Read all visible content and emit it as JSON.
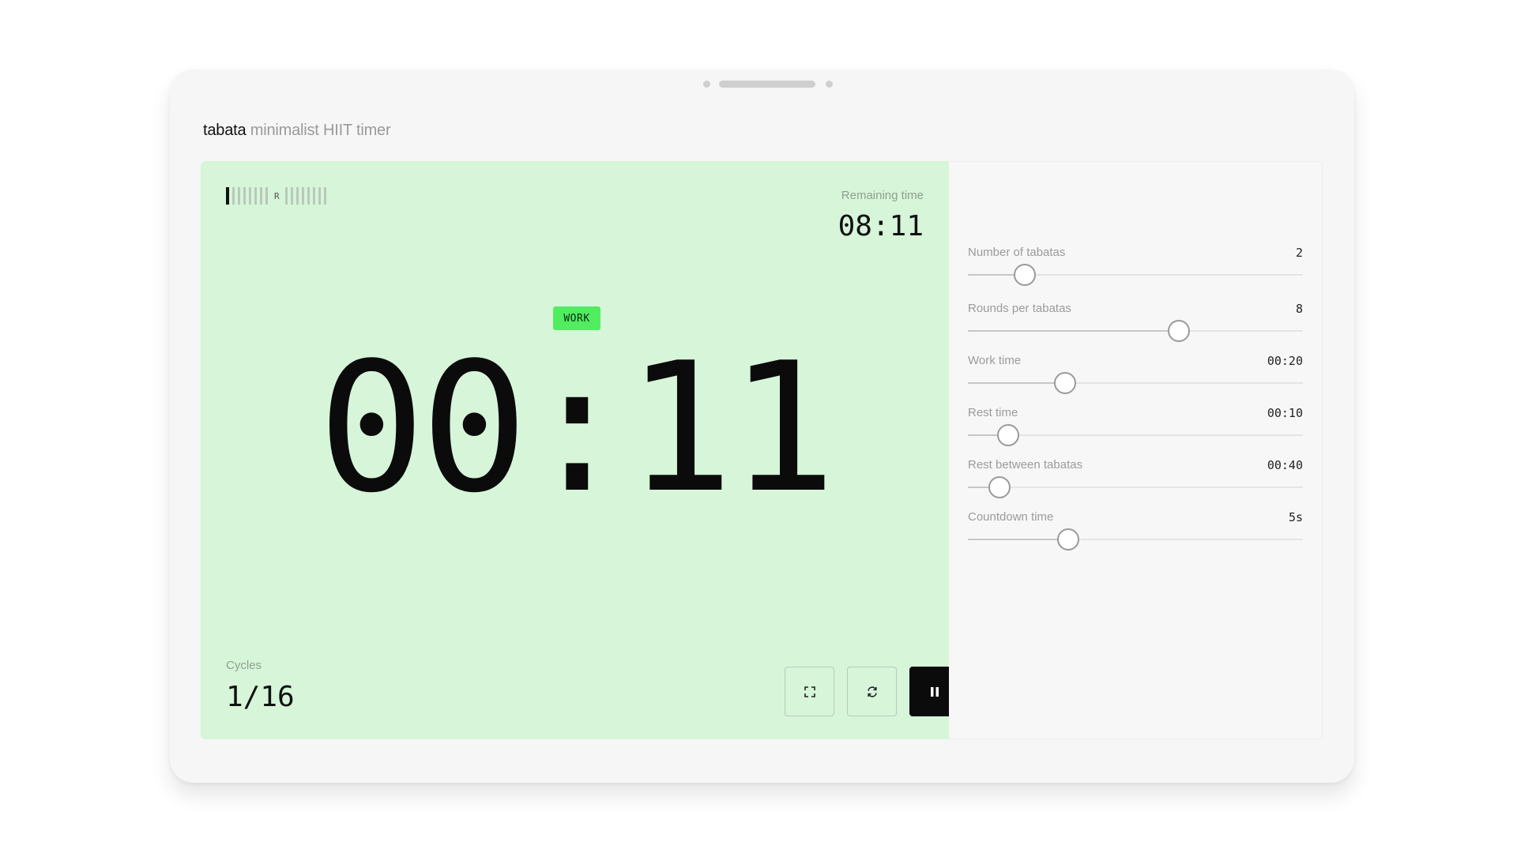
{
  "header": {
    "brand": "tabata",
    "tagline": "minimalist HIIT timer"
  },
  "timer": {
    "remaining_label": "Remaining time",
    "remaining_value": "08:11",
    "phase": "WORK",
    "current": "00:11",
    "cycles_label": "Cycles",
    "cycles_value": "1/16",
    "progress": {
      "ticks_before_marker": 8,
      "marker": "R",
      "ticks_after_marker": 8,
      "active_tick_index": 0
    }
  },
  "controls": {
    "fullscreen_icon": "expand-icon",
    "restart_icon": "refresh-icon",
    "pause_icon": "pause-icon"
  },
  "settings": [
    {
      "label": "Number of tabatas",
      "value": "2",
      "fraction": 0.17
    },
    {
      "label": "Rounds per tabatas",
      "value": "8",
      "fraction": 0.63
    },
    {
      "label": "Work time",
      "value": "00:20",
      "fraction": 0.29
    },
    {
      "label": "Rest time",
      "value": "00:10",
      "fraction": 0.12
    },
    {
      "label": "Rest between tabatas",
      "value": "00:40",
      "fraction": 0.095
    },
    {
      "label": "Countdown time",
      "value": "5s",
      "fraction": 0.3
    }
  ],
  "colors": {
    "work_bg": "#d6f5d9",
    "work_badge": "#50ed60",
    "primary": "#0b0b0b"
  }
}
